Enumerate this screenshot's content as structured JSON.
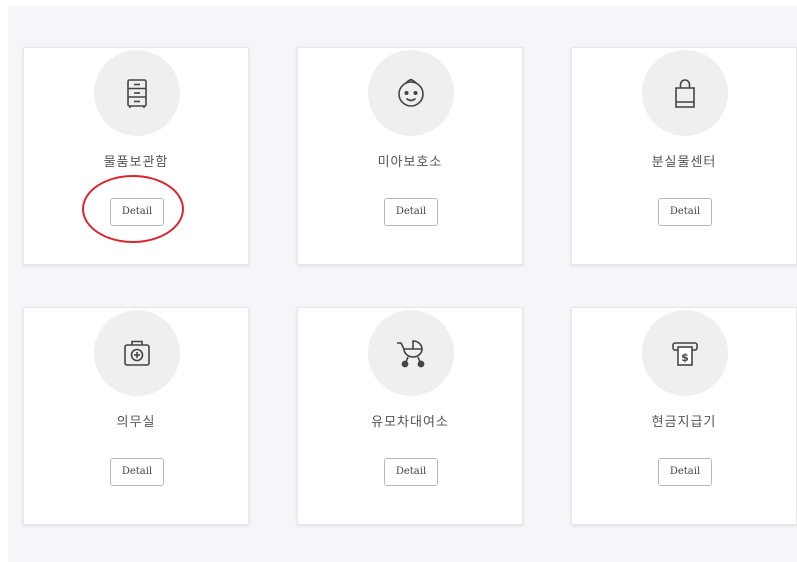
{
  "services": [
    {
      "label": "물품보관함",
      "detail_label": "Detail",
      "icon": "locker-icon"
    },
    {
      "label": "미아보호소",
      "detail_label": "Detail",
      "icon": "baby-face-icon"
    },
    {
      "label": "분실물센터",
      "detail_label": "Detail",
      "icon": "shopping-bag-icon"
    },
    {
      "label": "의무실",
      "detail_label": "Detail",
      "icon": "first-aid-kit-icon"
    },
    {
      "label": "유모차대여소",
      "detail_label": "Detail",
      "icon": "stroller-icon"
    },
    {
      "label": "현금지급기",
      "detail_label": "Detail",
      "icon": "atm-icon"
    }
  ],
  "colors": {
    "highlight": "#d8262f",
    "panel_background": "#f4f6f9"
  }
}
